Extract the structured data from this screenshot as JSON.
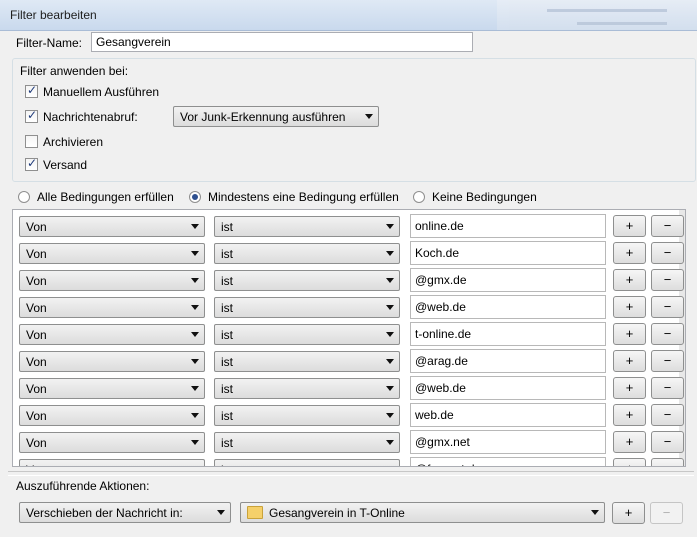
{
  "window": {
    "title": "Filter bearbeiten"
  },
  "filter_name": {
    "label": "Filter-Name:",
    "value": "Gesangverein"
  },
  "apply_group": {
    "title": "Filter anwenden bei:",
    "manual": {
      "label": "Manuellem Ausführen",
      "checked": true
    },
    "fetch": {
      "label": "Nachrichtenabruf:",
      "checked": true,
      "option": "Vor Junk-Erkennung ausführen"
    },
    "archive": {
      "label": "Archivieren",
      "checked": false
    },
    "send": {
      "label": "Versand",
      "checked": true
    }
  },
  "match": {
    "all": "Alle Bedingungen erfüllen",
    "any": "Mindestens eine Bedingung erfüllen",
    "none": "Keine Bedingungen",
    "selected": "any"
  },
  "conditions": [
    {
      "field": "Von",
      "op": "ist",
      "value": "online.de"
    },
    {
      "field": "Von",
      "op": "ist",
      "value": "Koch.de"
    },
    {
      "field": "Von",
      "op": "ist",
      "value": "@gmx.de"
    },
    {
      "field": "Von",
      "op": "ist",
      "value": "@web.de"
    },
    {
      "field": "Von",
      "op": "ist",
      "value": "t-online.de"
    },
    {
      "field": "Von",
      "op": "ist",
      "value": "@arag.de"
    },
    {
      "field": "Von",
      "op": "ist",
      "value": "@web.de"
    },
    {
      "field": "Von",
      "op": "ist",
      "value": "web.de"
    },
    {
      "field": "Von",
      "op": "ist",
      "value": "@gmx.net"
    },
    {
      "field": "Von",
      "op": "ist",
      "value": "@freenet.de"
    }
  ],
  "buttons": {
    "add": "+",
    "remove": "−"
  },
  "actions": {
    "title": "Auszuführende Aktionen:",
    "action": "Verschieben der Nachricht in:",
    "target": "Gesangverein in T-Online"
  },
  "colors": {
    "titlebar": "#c9d9ed",
    "accent": "#2d4f8f"
  }
}
